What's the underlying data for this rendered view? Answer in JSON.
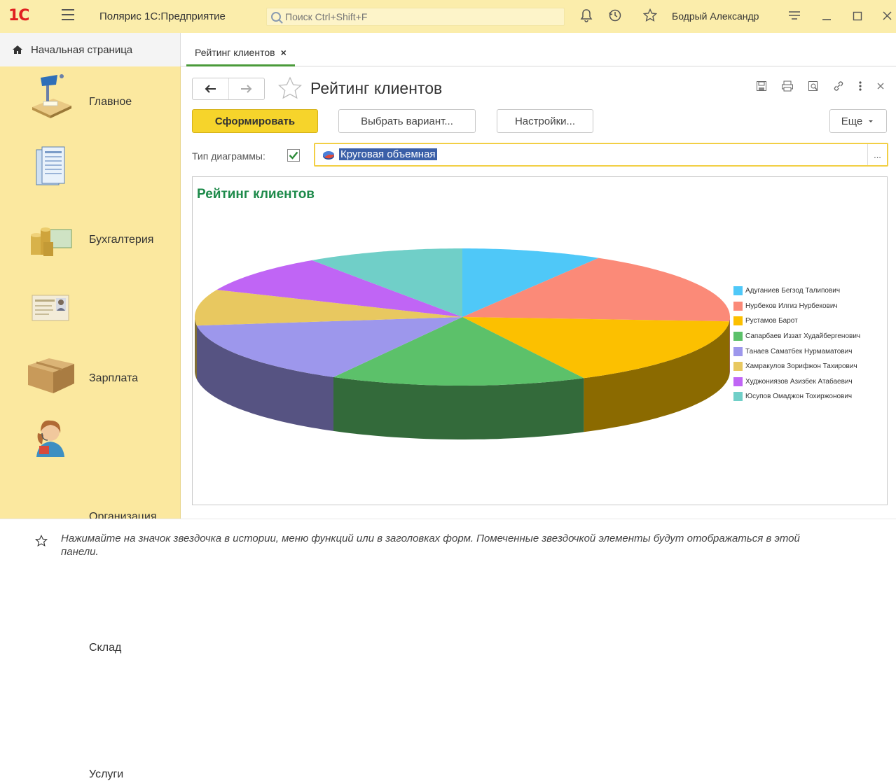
{
  "app": {
    "logo_text": "1С",
    "title": "Полярис 1С:Предприятие",
    "search_placeholder": "Поиск Ctrl+Shift+F",
    "user": "Бодрый Александр"
  },
  "tabs": {
    "home": "Начальная страница",
    "active": "Рейтинг клиентов",
    "close": "×"
  },
  "sidebar": {
    "items": [
      {
        "label": "Главное",
        "icon": "desk-lamp-icon"
      },
      {
        "label": "Бухгалтерия",
        "icon": "documents-icon"
      },
      {
        "label": "Зарплата",
        "icon": "coins-icon"
      },
      {
        "label": "Организация",
        "icon": "id-card-icon"
      },
      {
        "label": "Склад",
        "icon": "box-icon"
      },
      {
        "label": "Услуги",
        "icon": "operator-icon"
      }
    ]
  },
  "form": {
    "title": "Рейтинг клиентов",
    "buttons": {
      "generate": "Сформировать",
      "choose_variant": "Выбрать вариант...",
      "settings": "Настройки...",
      "more": "Еще"
    },
    "chart_type_label": "Тип диаграммы:",
    "chart_type_value": "Круговая объемная",
    "chart_type_enabled": true
  },
  "chart_data": {
    "type": "pie",
    "title": "Рейтинг клиентов",
    "style": "3d",
    "legend_position": "right",
    "series": [
      {
        "name": "Адуганиев Бегзод Талипович",
        "value": 8.5,
        "color": "#4fc8f8"
      },
      {
        "name": "Нурбеков Илгиз Нурбекович",
        "value": 17.5,
        "color": "#fb8a78"
      },
      {
        "name": "Рустамов Барот",
        "value": 16.5,
        "color": "#fcc000"
      },
      {
        "name": "Сапарбаев Иззат Худайбергенович",
        "value": 15.5,
        "color": "#5cc16a"
      },
      {
        "name": "Танаев Саматбек Нурмаматович",
        "value": 15.0,
        "color": "#9d97ec"
      },
      {
        "name": "Хамракулов Зорифжон Тахирович",
        "value": 8.5,
        "color": "#e8c860"
      },
      {
        "name": "Худжониязов Азизбек Атабаевич",
        "value": 9.0,
        "color": "#c065f5"
      },
      {
        "name": "Юсупов Омаджон Тохиржонович",
        "value": 9.5,
        "color": "#70cfc8"
      }
    ]
  },
  "favorites_hint": "Нажимайте на значок звездочка в истории, меню функций или в заголовках форм. Помеченные звездочкой элементы будут отображаться в этой панели."
}
